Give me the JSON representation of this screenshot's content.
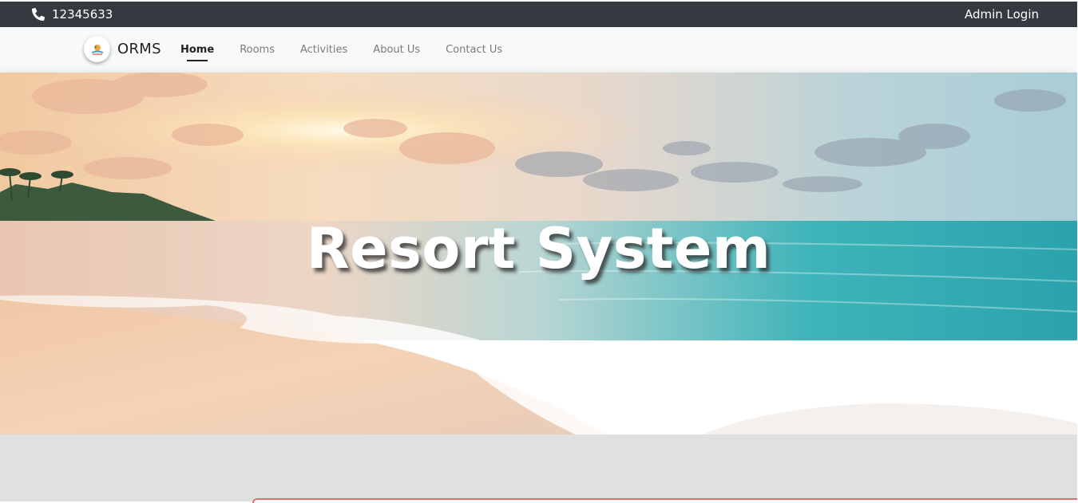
{
  "topbar": {
    "phone_icon": "phone-icon",
    "phone": "12345633",
    "admin_login": "Admin Login"
  },
  "navbar": {
    "brand_logo": "resort-logo-icon",
    "brand_name": "ORMS",
    "links": [
      {
        "label": "Home",
        "active": true
      },
      {
        "label": "Rooms",
        "active": false
      },
      {
        "label": "Activities",
        "active": false
      },
      {
        "label": "About Us",
        "active": false
      },
      {
        "label": "Contact Us",
        "active": false
      }
    ]
  },
  "hero": {
    "title": "Resort System",
    "image": "beach-sunset-image"
  },
  "colors": {
    "topbar_bg": "#343a40",
    "navbar_bg": "#f8f9fa",
    "page_bg": "#e0e0e0",
    "card_border": "#e07070"
  }
}
